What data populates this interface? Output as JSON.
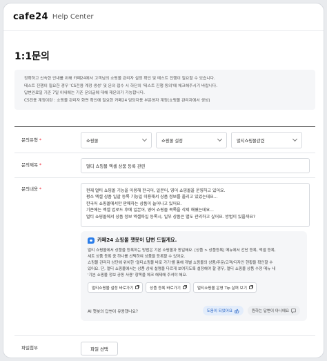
{
  "header": {
    "logo": "cafe24",
    "help_center": "Help Center"
  },
  "page": {
    "title": "1:1문의"
  },
  "notice": {
    "lines": [
      "정확하고 신속한 안내를 위해 카페24에서 고객님의 쇼핑몰 관리자 설정 확인 및 테스트 진행이 필요할 수 있습니다.",
      "테스트 진행이 필요한 경우 'CS전용 계정 생성' 및 문의 접수 시 하단의 '테스트 진행 동의'에 체크해주시기 바랍니다.",
      "답변완료일 기준 7일 이내에는 기존 문의글에 대해 재문의가 가능합니다.",
      "CS전용 계정이란 : 쇼핑몰 관리자 화면 확인에 필요한 카페24 담당자용 부운영자 계정(쇼핑몰 관리자에서 생성)"
    ]
  },
  "form": {
    "type": {
      "label": "문의유형",
      "req": "*",
      "options": [
        "쇼핑몰",
        "쇼핑몰 설정",
        "멀티쇼핑몰관련"
      ]
    },
    "subject": {
      "label": "문의제목",
      "req": "*",
      "value": "멀티 쇼핑몰 엑셀 상품 등록 관련"
    },
    "content": {
      "label": "문의내용",
      "req": "*",
      "lines": [
        "현재 멀티 쇼핑몰 기능을 이용해 한국어, 일본어, 영어 쇼핑몰을 운영하고 있어요.",
        "평소 엑셀 상품 일괄 등록 기능일 이용해서 상품 정보를 올리고 있었는데요...",
        "한국어 쇼핑몰에서만 판매하는 상품이 늘어나고 있어요.",
        "기존에는 엑셀 업로드 후에 일본어, 영어 쇼핑몰 목록을 삭제 해줬는데요...",
        "멀티 쇼핑몰에서 상품 정보 엑셀파일 등록시, 일부 상품은 별도 관리하고 싶어요. 방법이 있을까요?"
      ]
    },
    "bot": {
      "title": "카페24 쇼핑몰 챗봇이 답변 드릴게요.",
      "lines": [
        "멀티 쇼핑몰에서 상품을 등록하는 방법은 기본 쇼핑몰과 동일해요. [상품 > 상품등록] 메뉴에서 간단 등록, 엑셀 등록,",
        "세트 상품 등록 중 하나를 선택하여 상품을 등록할 수 있어요.",
        "쇼핑몰 관리자 상단에 위치한 '멀티쇼핑몰 바로 가기'를 통해 개별 쇼핑몰의 상품/주문/고객/디자인 현황을 확인할 수",
        "있어요. 단, 멀티 쇼핑몰에서는 상품 상세 설명을 다르게 보여지도록 설정해야 할 경우, 멀티 쇼핑몰 상품 수정 메뉴 내",
        "'기본 쇼핑몰 정보 공동 사용' 항목을 체크 해제해 주셔야 해요."
      ],
      "links": [
        "멀티쇼핑몰 설정 바로가기",
        "상품 등록 바로가기",
        "멀티쇼핑몰 운영 Tip 살펴 보기"
      ],
      "feedback_question": "AI 챗봇의 답변이 유용했나요?",
      "yes_label": "도움이 되었어요",
      "no_label": "원하는 답변이 아니에요"
    },
    "attach": {
      "label": "파일첨부",
      "button": "파일 선택"
    }
  },
  "colors": {
    "accent": "#2b7de9",
    "required": "#ee2233"
  }
}
